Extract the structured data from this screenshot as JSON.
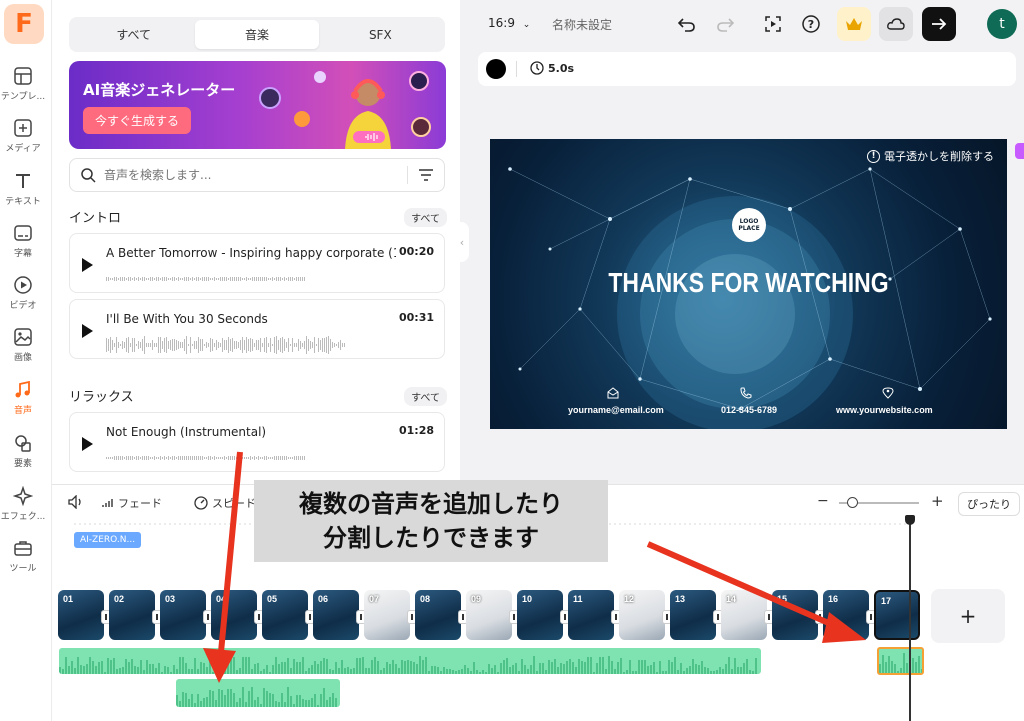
{
  "rail": {
    "items": [
      {
        "label": "テンプレ..."
      },
      {
        "label": "メディア"
      },
      {
        "label": "テキスト"
      },
      {
        "label": "字幕"
      },
      {
        "label": "ビデオ"
      },
      {
        "label": "画像"
      },
      {
        "label": "音声"
      },
      {
        "label": "要素"
      },
      {
        "label": "エフェク..."
      },
      {
        "label": "ツール"
      }
    ],
    "active_index": 6
  },
  "panel": {
    "tabs": [
      "すべて",
      "音楽",
      "SFX"
    ],
    "active_tab": 1,
    "banner": {
      "title": "AI音楽ジェネレーター",
      "button": "今すぐ生成する"
    },
    "search_placeholder": "音声を検索します...",
    "sections": [
      {
        "title": "イントロ",
        "see_all": "すべて",
        "tracks": [
          {
            "name": "A Better Tomorrow - Inspiring happy corporate (1...",
            "duration": "00:20"
          },
          {
            "name": "I'll Be With You 30 Seconds",
            "duration": "00:31"
          }
        ]
      },
      {
        "title": "リラックス",
        "see_all": "すべて",
        "tracks": [
          {
            "name": "Not Enough (Instrumental)",
            "duration": "01:28"
          }
        ]
      }
    ]
  },
  "topbar": {
    "ratio": "16:9",
    "doc_name": "名称未設定"
  },
  "properties": {
    "duration": "5.0s"
  },
  "video": {
    "watermark": "電子透かしを削除する",
    "logo_text": "LOGO PLACE",
    "headline": "THANKS FOR WATCHING",
    "email": "yourname@email.com",
    "phone": "012-345-6789",
    "website": "www.yourwebsite.com"
  },
  "timeline": {
    "tools": [
      "フェード",
      "スピード"
    ],
    "fit_label": "ぴったり",
    "track_label": "AI-ZERO.N...",
    "scenes": [
      "01",
      "02",
      "03",
      "04",
      "05",
      "06",
      "07",
      "08",
      "09",
      "10",
      "11",
      "12",
      "13",
      "14",
      "15",
      "16",
      "17"
    ],
    "selected_scene": 16
  },
  "overlay": {
    "line1": "複数の音声を追加したり",
    "line2": "分割したりできます"
  },
  "colors": {
    "accent": "#ff6a1a",
    "audio": "#7ee3b0",
    "arrow": "#e8331f"
  }
}
